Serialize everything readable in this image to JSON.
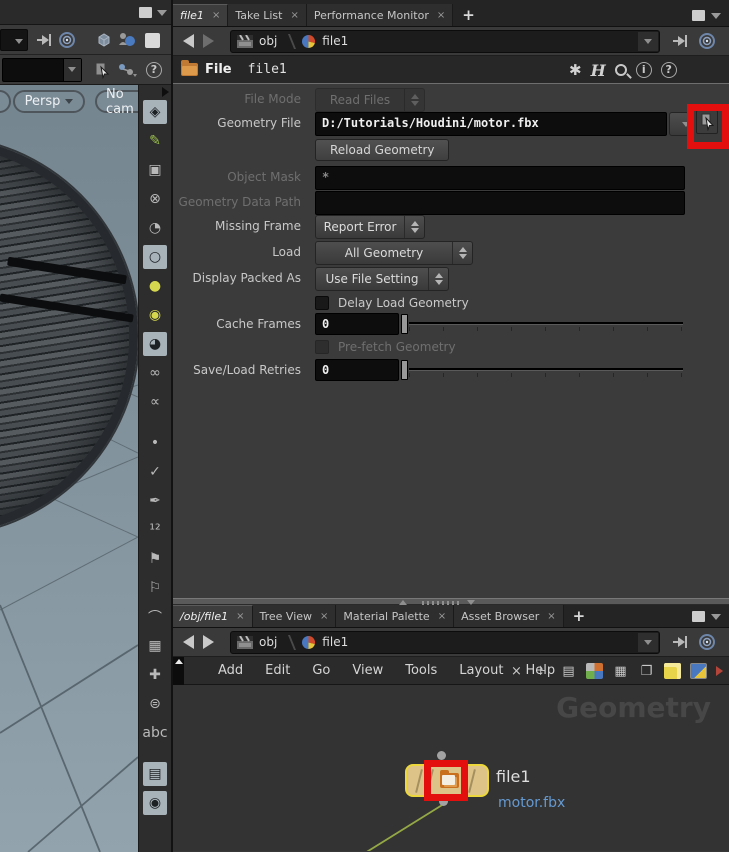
{
  "colors": {
    "highlight_red": "#e30f0f",
    "node_fill": "#ddc387",
    "node_outline": "#ecd83c",
    "wire_green": "#94a845",
    "annotation_blue": "#659ad2"
  },
  "left_pane": {
    "viewport": {
      "camera_pills": [
        {
          "label": "Persp"
        },
        {
          "label": "No cam"
        }
      ],
      "display_toolbar": [
        {
          "name": "shading-mode-icon",
          "glyph": "◈",
          "active": true
        },
        {
          "name": "lasso-select-icon",
          "glyph": "✎",
          "color": "#9bc050"
        },
        {
          "name": "lock-icon",
          "glyph": "▣"
        },
        {
          "name": "headlight-off-icon",
          "glyph": "⊗"
        },
        {
          "name": "clock-icon",
          "glyph": "◔"
        },
        {
          "name": "default-lighting-icon",
          "glyph": "○",
          "active": true
        },
        {
          "name": "normal-lights-icon",
          "glyph": "●",
          "color": "#d5d84e"
        },
        {
          "name": "high-quality-lighting-icon",
          "glyph": "◉",
          "color": "#d5d84e"
        },
        {
          "name": "material-shading-icon",
          "glyph": "◕",
          "active": true
        },
        {
          "name": "stereo-glasses-icon",
          "glyph": "∞"
        },
        {
          "name": "snapshot-icon",
          "glyph": "∝"
        },
        {
          "name": "points-display-icon",
          "glyph": "•",
          "gap": true
        },
        {
          "name": "point-normals-icon",
          "glyph": "✓"
        },
        {
          "name": "point-markers-icon",
          "glyph": "✒"
        },
        {
          "name": "point-numbers-icon",
          "glyph": "¹²"
        },
        {
          "name": "prim-normals-icon",
          "glyph": "⚑"
        },
        {
          "name": "prim-numbers-icon",
          "glyph": "⚐"
        },
        {
          "name": "hull-display-icon",
          "glyph": "⌒"
        },
        {
          "name": "uv-grid-icon",
          "glyph": "▦"
        },
        {
          "name": "axis-icon",
          "glyph": "✚"
        },
        {
          "name": "group-list-icon",
          "glyph": "⊜"
        },
        {
          "name": "text-overlay-icon",
          "glyph": "abc"
        },
        {
          "name": "background-image-icon",
          "glyph": "▤",
          "active": true,
          "gap": true
        },
        {
          "name": "view-pin-icon",
          "glyph": "◉",
          "active": true
        }
      ]
    },
    "help_glyph": "?"
  },
  "param_pane": {
    "tabs": [
      {
        "label": "file1",
        "close": "×",
        "active": true
      },
      {
        "label": "Take List",
        "close": "×"
      },
      {
        "label": "Performance Monitor",
        "close": "×"
      }
    ],
    "add_tab_label": "+",
    "path": {
      "context": "obj",
      "node": "file1"
    },
    "header": {
      "type_label": "File",
      "node_name": "file1",
      "gear_glyph": "✱",
      "houdini_glyph": "H",
      "info_glyph": "i",
      "help_glyph": "?"
    },
    "rows": {
      "file_mode": {
        "label": "File Mode",
        "value": "Read Files"
      },
      "geometry_file": {
        "label": "Geometry File",
        "value": "D:/Tutorials/Houdini/motor.fbx"
      },
      "reload_label": "Reload Geometry",
      "object_mask": {
        "label": "Object Mask",
        "value": "*"
      },
      "geometry_data_path": {
        "label": "Geometry Data Path",
        "value": ""
      },
      "missing_frame": {
        "label": "Missing Frame",
        "value": "Report Error"
      },
      "load": {
        "label": "Load",
        "value": "All Geometry"
      },
      "display_packed_as": {
        "label": "Display Packed As",
        "value": "Use File Setting"
      },
      "delay_load_geometry": {
        "label": "Delay Load Geometry"
      },
      "cache_frames": {
        "label": "Cache Frames",
        "value": "0"
      },
      "prefetch_geometry": {
        "label": "Pre-fetch Geometry"
      },
      "save_load_retries": {
        "label": "Save/Load Retries",
        "value": "0"
      }
    }
  },
  "network_pane": {
    "tabs": [
      {
        "label": "/obj/file1",
        "close": "×",
        "active": true
      },
      {
        "label": "Tree View",
        "close": "×"
      },
      {
        "label": "Material Palette",
        "close": "×"
      },
      {
        "label": "Asset Browser",
        "close": "×"
      }
    ],
    "add_tab_label": "+",
    "path": {
      "context": "obj",
      "node": "file1"
    },
    "menu_items": [
      "Add",
      "Edit",
      "Go",
      "View",
      "Tools",
      "Layout",
      "Help"
    ],
    "menubar_icons": [
      {
        "name": "tools-icon",
        "glyph": "×"
      },
      {
        "name": "tree-view-icon",
        "glyph": "⊦"
      },
      {
        "name": "list-view-icon",
        "glyph": "▤"
      },
      {
        "name": "color-grid-icon",
        "glyph": "",
        "cls": "colorgrid"
      },
      {
        "name": "thumbnail-grid-icon",
        "glyph": "▦"
      },
      {
        "name": "layout-panes-icon",
        "glyph": "❐"
      },
      {
        "name": "sticky-note-icon",
        "glyph": "",
        "cls": "note"
      },
      {
        "name": "background-image-icon",
        "glyph": "",
        "cls": "imgframe"
      },
      {
        "name": "more-icon",
        "glyph": "",
        "cls": "arrow"
      }
    ],
    "watermark": "Geometry",
    "node": {
      "name": "file1",
      "annotation": "motor.fbx"
    }
  }
}
